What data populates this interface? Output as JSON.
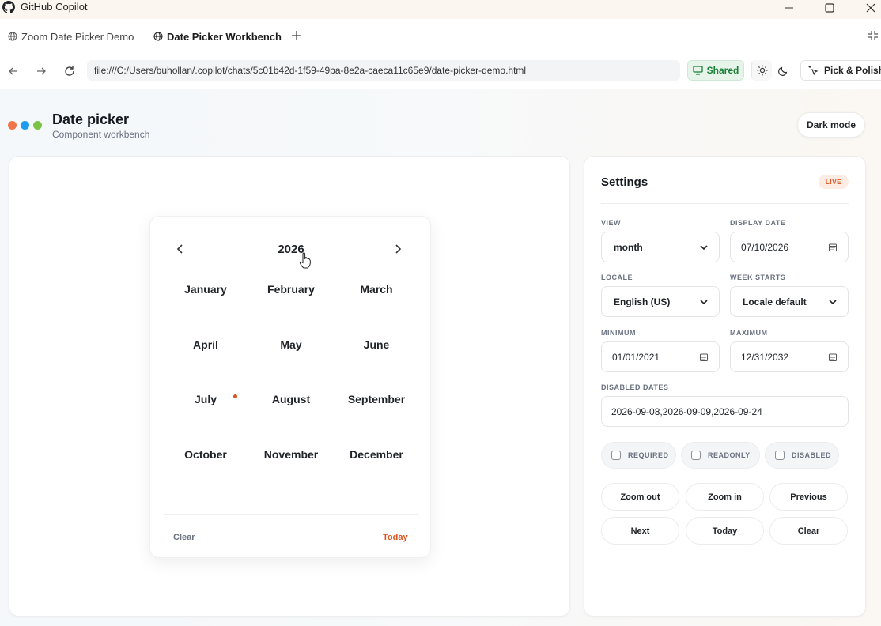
{
  "window": {
    "title": "GitHub Copilot"
  },
  "tabs": [
    {
      "label": "Zoom Date Picker Demo"
    },
    {
      "label": "Date Picker Workbench"
    }
  ],
  "address": {
    "url": "file:///C:/Users/buhollan/.copilot/chats/5c01b42d-1f59-49ba-8e2a-caeca11c65e9/date-picker-demo.html",
    "shared_label": "Shared",
    "pick_label": "Pick & Polish"
  },
  "header": {
    "title": "Date picker",
    "subtitle": "Component workbench",
    "dark_mode_label": "Dark mode",
    "dot_colors": [
      "#f0744a",
      "#1d9bf0",
      "#7cc243"
    ]
  },
  "picker": {
    "year": "2026",
    "months": [
      "January",
      "February",
      "March",
      "April",
      "May",
      "June",
      "July",
      "August",
      "September",
      "October",
      "November",
      "December"
    ],
    "clear_label": "Clear",
    "today_label": "Today",
    "accent_color": "#d9541e"
  },
  "settings": {
    "title": "Settings",
    "badge": "LIVE",
    "view": {
      "label": "VIEW",
      "value": "month"
    },
    "display_date": {
      "label": "DISPLAY DATE",
      "value": "07/10/2026"
    },
    "locale": {
      "label": "LOCALE",
      "value": "English (US)"
    },
    "week_starts": {
      "label": "WEEK STARTS",
      "value": "Locale default"
    },
    "minimum": {
      "label": "MINIMUM",
      "value": "01/01/2021"
    },
    "maximum": {
      "label": "MAXIMUM",
      "value": "12/31/2032"
    },
    "disabled_dates": {
      "label": "DISABLED DATES",
      "value": "2026-09-08,2026-09-09,2026-09-24"
    },
    "checks": [
      {
        "label": "REQUIRED"
      },
      {
        "label": "READONLY"
      },
      {
        "label": "DISABLED"
      }
    ],
    "actions": [
      {
        "label": "Zoom out"
      },
      {
        "label": "Zoom in"
      },
      {
        "label": "Previous"
      },
      {
        "label": "Next"
      },
      {
        "label": "Today"
      },
      {
        "label": "Clear"
      }
    ]
  }
}
